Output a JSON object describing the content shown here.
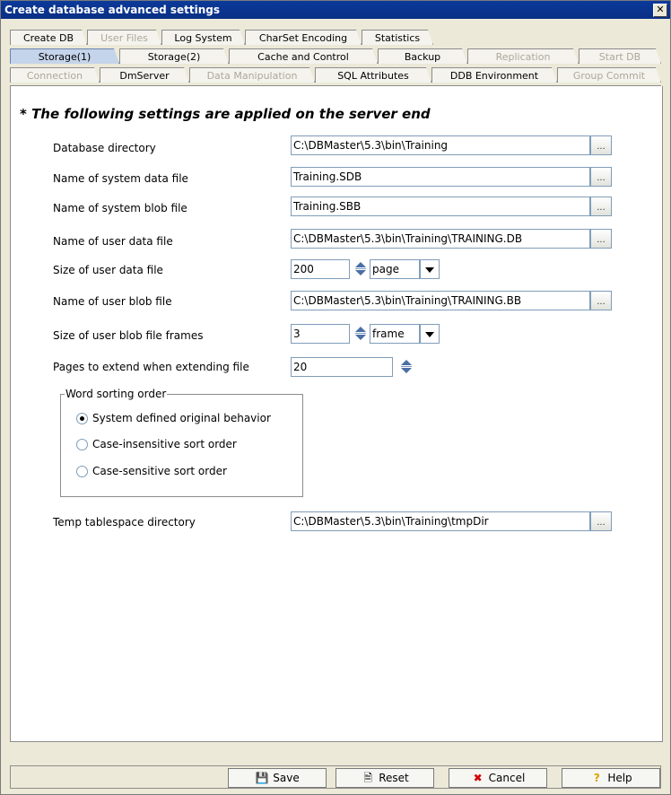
{
  "window": {
    "title": "Create database advanced settings",
    "close": "✕"
  },
  "tabs": {
    "row1": [
      {
        "label": "Create DB",
        "disabled": false
      },
      {
        "label": "User Files",
        "disabled": true
      },
      {
        "label": "Log System",
        "disabled": false
      },
      {
        "label": "CharSet Encoding",
        "disabled": false
      },
      {
        "label": "Statistics",
        "disabled": false
      }
    ],
    "row2": [
      {
        "label": "Storage(1)",
        "selected": true
      },
      {
        "label": "Storage(2)"
      },
      {
        "label": "Cache and Control"
      },
      {
        "label": "Backup"
      },
      {
        "label": "Replication",
        "disabled": true
      },
      {
        "label": "Start DB",
        "disabled": true
      }
    ],
    "row3": [
      {
        "label": "Connection",
        "disabled": true
      },
      {
        "label": "DmServer"
      },
      {
        "label": "Data Manipulation",
        "disabled": true
      },
      {
        "label": "SQL Attributes"
      },
      {
        "label": "DDB Environment"
      },
      {
        "label": "Group Commit",
        "disabled": true
      }
    ]
  },
  "settings": {
    "heading": "* The following settings are applied on the server end",
    "db_dir_label": "Database directory",
    "db_dir_value": "C:\\DBMaster\\5.3\\bin\\Training",
    "sys_data_label": "Name of system data file",
    "sys_data_value": "Training.SDB",
    "sys_blob_label": "Name of system blob file",
    "sys_blob_value": "Training.SBB",
    "user_data_label": "Name of user data file",
    "user_data_value": "C:\\DBMaster\\5.3\\bin\\Training\\TRAINING.DB",
    "user_data_size_label": "Size of user data file",
    "user_data_size_value": "200",
    "user_data_size_unit": "page",
    "user_blob_label": "Name of user blob file",
    "user_blob_value": "C:\\DBMaster\\5.3\\bin\\Training\\TRAINING.BB",
    "user_blob_frames_label": "Size of user blob file frames",
    "user_blob_frames_value": "3",
    "user_blob_frames_unit": "frame",
    "extend_pages_label": "Pages to extend when extending file",
    "extend_pages_value": "20",
    "browse": "...",
    "sort_group_title": "Word sorting order",
    "sort_options": [
      "System defined original behavior",
      "Case-insensitive sort order",
      "Case-sensitive sort order"
    ],
    "sort_selected_index": 0,
    "temp_dir_label": "Temp tablespace directory",
    "temp_dir_value": "C:\\DBMaster\\5.3\\bin\\Training\\tmpDir"
  },
  "buttons": {
    "save": "Save",
    "reset": "Reset",
    "cancel": "Cancel",
    "help": "Help"
  }
}
